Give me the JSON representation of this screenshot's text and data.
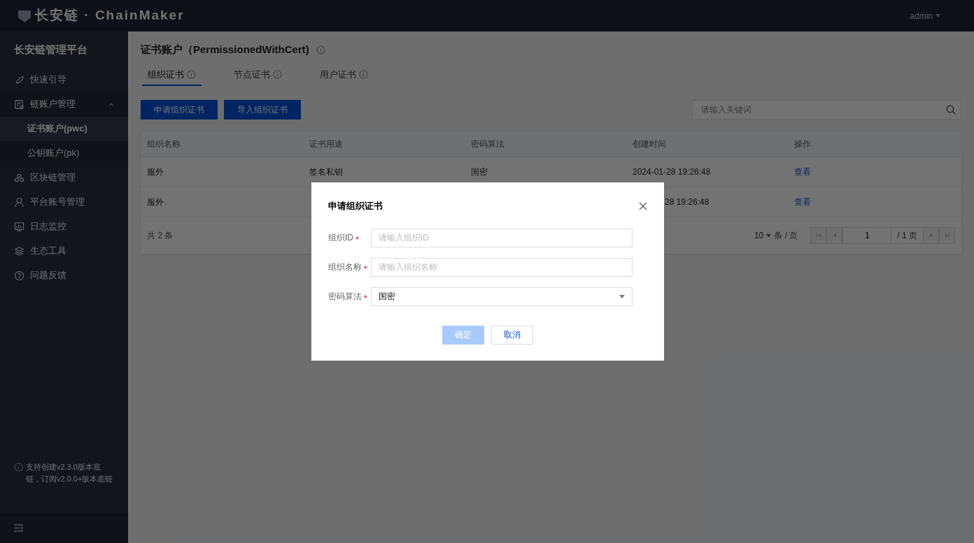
{
  "header": {
    "logo_text": "长安链 · ChainMaker",
    "user": "admin"
  },
  "sidebar": {
    "title": "长安链管理平台",
    "items": [
      {
        "label": "快速引导"
      },
      {
        "label": "链账户管理",
        "expanded": true,
        "children": [
          {
            "label": "证书账户(pwc)",
            "selected": true
          },
          {
            "label": "公钥账户(pk)",
            "selected": false
          }
        ]
      },
      {
        "label": "区块链管理"
      },
      {
        "label": "平台账号管理"
      },
      {
        "label": "日志监控"
      },
      {
        "label": "生态工具"
      },
      {
        "label": "问题反馈"
      }
    ],
    "notice": "支持创建v2.3.0版本底链，订阅v2.0.0+版本底链"
  },
  "page": {
    "title": "证书账户（PermissionedWithCert)",
    "tabs": [
      {
        "label": "组织证书",
        "selected": true
      },
      {
        "label": "节点证书",
        "selected": false
      },
      {
        "label": "用户证书",
        "selected": false
      }
    ],
    "buttons": [
      "申请组织证书",
      "导入组织证书"
    ],
    "search": {
      "placeholder": "请输入关键词"
    },
    "table": {
      "columns": [
        "组织名称",
        "证书用途",
        "密码算法",
        "创建时间",
        "操作"
      ],
      "rows": [
        {
          "covered": false,
          "cells": [
            "服外",
            "签名私钥",
            "国密",
            "2024-01-28 19:26:48",
            "查看"
          ]
        },
        {
          "covered": true,
          "cells": [
            "服外",
            "",
            "",
            "28 19:26:48",
            "查看"
          ]
        }
      ]
    },
    "pagination": {
      "total": "共 2 条",
      "page_size": "10",
      "per_page": "条 / 页",
      "page": "1",
      "pages": "/ 1 页"
    }
  },
  "dialog": {
    "title": "申请组织证书",
    "fields": [
      {
        "kind": "input",
        "label": "组织ID",
        "required": true,
        "placeholder": "请输入组织ID"
      },
      {
        "kind": "input",
        "label": "组织名称",
        "required": true,
        "placeholder": "请输入组织名称"
      },
      {
        "kind": "select",
        "label": "密码算法",
        "required": true,
        "value": "国密"
      }
    ],
    "buttons": [
      {
        "label": "确定",
        "disabled": true,
        "primary": true
      },
      {
        "label": "取消",
        "disabled": false,
        "primary": false
      }
    ]
  }
}
